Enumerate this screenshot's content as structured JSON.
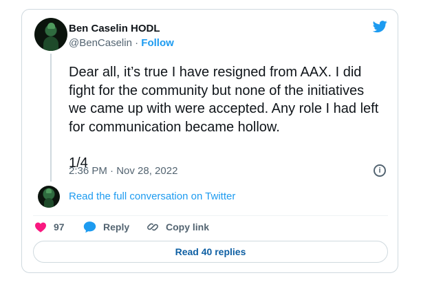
{
  "tweet": {
    "author_name": "Ben Caselin HODL",
    "handle": "@BenCaselin",
    "separator": "·",
    "follow_label": "Follow",
    "text_lines": [
      "Dear all, it’s true I have resigned from AAX. I did",
      "fight for the community but none of the initiatives",
      "we came up with were accepted. Any role I had left",
      "for communication became hollow."
    ],
    "thread_counter": "1/4",
    "timestamp": "2:36 PM · Nov 28, 2022",
    "read_full_label": "Read the full conversation on Twitter"
  },
  "actions": {
    "like_count": "97",
    "reply_label": "Reply",
    "copy_link_label": "Copy link"
  },
  "read_replies_label": "Read 40 replies",
  "icons": {
    "brand": "twitter-bird-icon",
    "info": "info-icon",
    "like": "heart-icon",
    "reply": "speech-bubble-icon",
    "copy": "link-icon"
  },
  "colors": {
    "accent": "#1d9bf0",
    "like": "#f91880",
    "secondary_text": "#536471",
    "border": "#cfd9de",
    "replies_text": "#0e5fa3"
  }
}
